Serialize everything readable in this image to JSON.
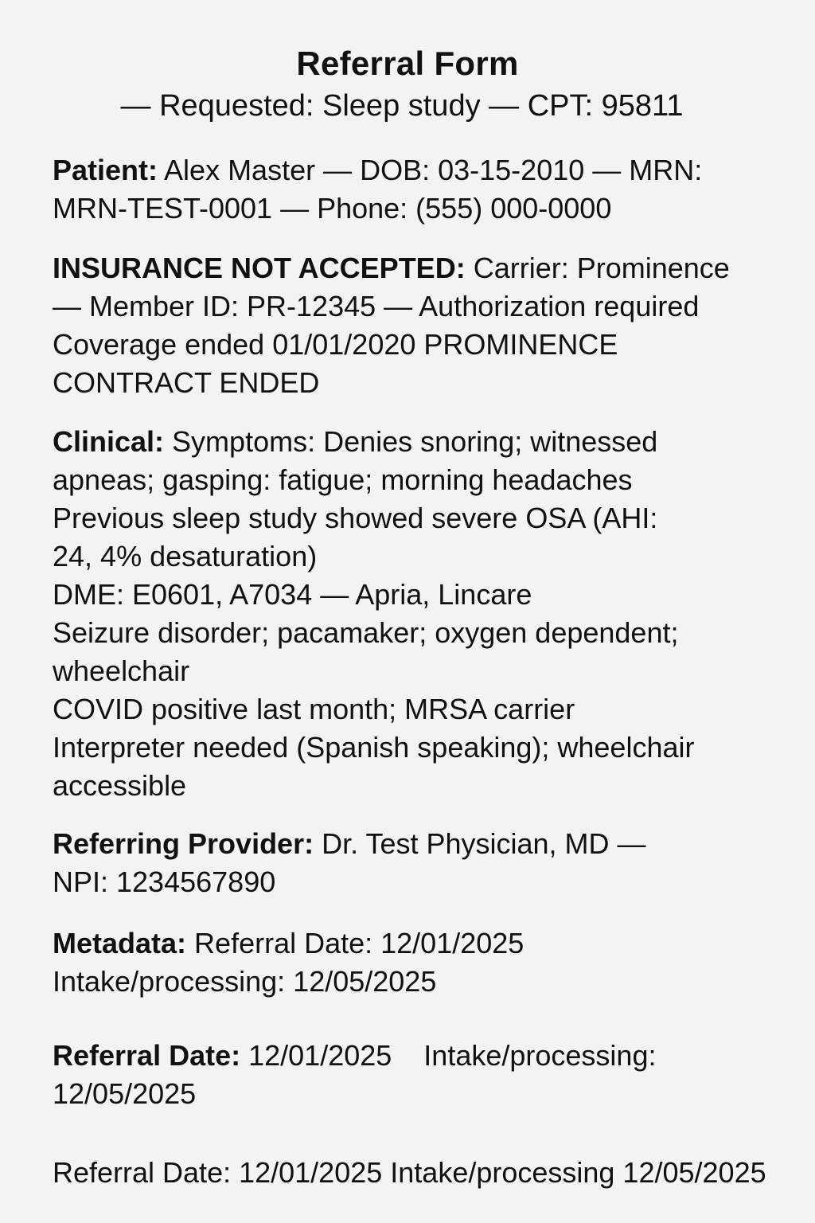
{
  "title": "Referral Form",
  "subtitle": "— Requested: Sleep study — CPT: 95811",
  "patient": {
    "label": "Patient:",
    "line1": "Alex Master — DOB: 03-15-2010 — MRN:",
    "line2": "MRN-TEST-0001 — Phone: (555) 000-0000"
  },
  "insurance": {
    "label": "INSURANCE NOT ACCEPTED:",
    "line1": "Carrier: Prominence",
    "line2": "— Member ID: PR-12345 — Authorization required",
    "line3": "Coverage ended 01/01/2020  PROMINENCE",
    "line4": "CONTRACT ENDED"
  },
  "clinical": {
    "label": "Clinical:",
    "line1": "Symptoms: Denies snoring; witnessed",
    "line2": "apneas; gasping: fatigue; morning headaches",
    "line3": "Previous sleep study showed severe OSA (AHI:",
    "line4": "24, 4% desaturation)",
    "line5": "DME: E0601, A7034 — Apria, Lincare",
    "line6": "Seizure disorder; pacamaker; oxygen dependent;",
    "line7": "wheelchair",
    "line8": "COVID positive last month; MRSA carrier",
    "line9": "Interpreter needed (Spanish speaking); wheelchair",
    "line10": "accessible"
  },
  "provider": {
    "label": "Referring Provider:",
    "line1": "Dr. Test Physician, MD —",
    "line2": "NPI: 1234567890"
  },
  "metadata": {
    "label": "Metadata:",
    "line1": "Referral Date: 12/01/2025",
    "line2": "Intake/processing: 12/05/2025"
  },
  "dates": {
    "label": "Referral Date:",
    "value": "12/01/2025",
    "intake": "Intake/processing:",
    "line2": "12/05/2025"
  },
  "footer": {
    "text": "Referral Date: 12/01/2025 Intake/processing 12/05/2025"
  }
}
